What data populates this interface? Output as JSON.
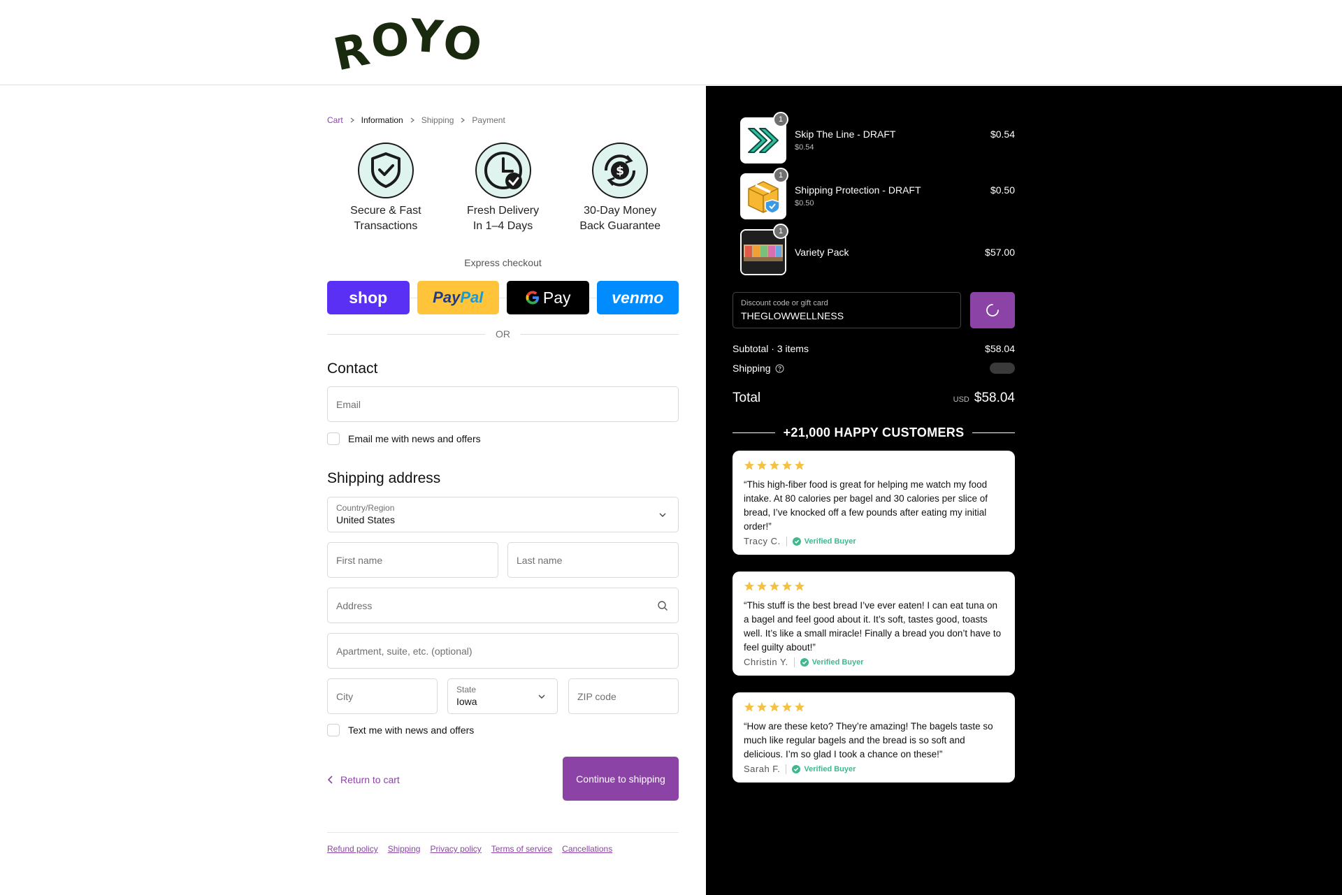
{
  "header": {
    "logo_text": "ROYO"
  },
  "breadcrumb": {
    "items": [
      {
        "label": "Cart"
      },
      {
        "label": "Information"
      },
      {
        "label": "Shipping"
      },
      {
        "label": "Payment"
      }
    ]
  },
  "badges": [
    {
      "icon": "shield-check-icon",
      "line1": "Secure & Fast",
      "line2": "Transactions"
    },
    {
      "icon": "clock-check-icon",
      "line1": "Fresh Delivery",
      "line2": "In 1–4 Days"
    },
    {
      "icon": "money-back-icon",
      "line1": "30-Day Money",
      "line2": "Back Guarantee"
    }
  ],
  "express": {
    "label": "Express checkout",
    "shop": "shop",
    "paypal_a": "Pay",
    "paypal_b": "Pal",
    "gpay": "Pay",
    "venmo": "venmo",
    "or": "OR"
  },
  "contact": {
    "title": "Contact",
    "email_placeholder": "Email",
    "newsletter_label": "Email me with news and offers"
  },
  "shipping": {
    "title": "Shipping address",
    "country_label": "Country/Region",
    "country_value": "United States",
    "first_name_placeholder": "First name",
    "last_name_placeholder": "Last name",
    "address_placeholder": "Address",
    "apartment_placeholder": "Apartment, suite, etc. (optional)",
    "city_placeholder": "City",
    "state_label": "State",
    "state_value": "Iowa",
    "zip_placeholder": "ZIP code",
    "sms_label": "Text me with news and offers"
  },
  "actions": {
    "return_label": "Return to cart",
    "continue_label": "Continue to shipping"
  },
  "footer": {
    "links": [
      "Refund policy",
      "Shipping",
      "Privacy policy",
      "Terms of service",
      "Cancellations"
    ]
  },
  "order": {
    "items": [
      {
        "name": "Skip The Line - DRAFT",
        "sub": "$0.54",
        "price": "$0.54",
        "qty": "1",
        "thumb_icon": "double-chevron-icon"
      },
      {
        "name": "Shipping Protection - DRAFT",
        "sub": "$0.50",
        "price": "$0.50",
        "qty": "1",
        "thumb_icon": "package-shield-icon"
      },
      {
        "name": "Variety Pack",
        "price": "$57.00",
        "qty": "1",
        "thumb_icon": "variety-pack-image"
      }
    ],
    "discount_label": "Discount code or gift card",
    "discount_value": "THEGLOWWELLNESS",
    "subtotal_label": "Subtotal · 3 items",
    "subtotal_value": "$58.04",
    "shipping_label": "Shipping",
    "total_label": "Total",
    "total_currency": "USD",
    "total_value": "$58.04"
  },
  "reviews": {
    "heading": "+21,000 HAPPY CUSTOMERS",
    "rating": 5,
    "verified_label": "Verified Buyer",
    "items": [
      {
        "text": "“This high-fiber food is great for helping me watch my food intake. At 80 calories per bagel and 30 calories per slice of bread, I’ve knocked off a few pounds after eating my initial order!”",
        "author": "Tracy C."
      },
      {
        "text": "“This stuff is the best bread I’ve ever eaten! I can eat tuna on a bagel and feel good about it. It’s soft, tastes good, toasts well. It’s like a small miracle! Finally a bread you don’t have to feel guilty about!”",
        "author": "Christin Y."
      },
      {
        "text": "“How are these keto? They’re amazing! The bagels taste so much like regular bagels and the bread is so soft and delicious. I’m so glad I took a chance on these!”",
        "author": "Sarah F."
      }
    ]
  },
  "colors": {
    "accent": "#8b44a5",
    "shop_pay": "#5a31f4",
    "paypal": "#ffc439",
    "venmo": "#008cff",
    "verified": "#3fb88c",
    "star": "#f5c142"
  }
}
